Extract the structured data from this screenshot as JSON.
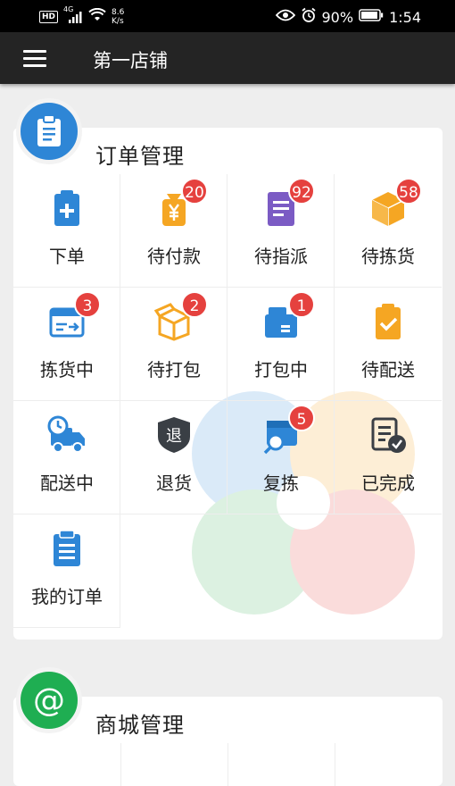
{
  "status_bar": {
    "hd": "HD",
    "network": "4G",
    "speed_value": "8.6",
    "speed_unit": "K/s",
    "battery": "90%",
    "time": "1:54"
  },
  "toolbar": {
    "title": "第一店铺"
  },
  "order_section": {
    "title": "订单管理",
    "items": [
      {
        "label": "下单",
        "icon": "clipboard-plus-icon"
      },
      {
        "label": "待付款",
        "icon": "yen-bag-icon",
        "count": "20"
      },
      {
        "label": "待指派",
        "icon": "document-list-icon",
        "count": "92"
      },
      {
        "label": "待拣货",
        "icon": "box-icon",
        "count": "58"
      },
      {
        "label": "拣货中",
        "icon": "scan-box-icon",
        "count": "3"
      },
      {
        "label": "待打包",
        "icon": "open-box-icon",
        "count": "2"
      },
      {
        "label": "打包中",
        "icon": "packing-box-icon",
        "count": "1"
      },
      {
        "label": "待配送",
        "icon": "clipboard-check-icon"
      },
      {
        "label": "配送中",
        "icon": "delivery-truck-icon"
      },
      {
        "label": "退货",
        "icon": "return-shield-icon",
        "badge_text": "退"
      },
      {
        "label": "复拣",
        "icon": "box-search-icon",
        "count": "5"
      },
      {
        "label": "已完成",
        "icon": "document-done-icon"
      },
      {
        "label": "我的订单",
        "icon": "clipboard-list-icon"
      }
    ]
  },
  "mall_section": {
    "title": "商城管理",
    "badge_symbol": "@"
  }
}
